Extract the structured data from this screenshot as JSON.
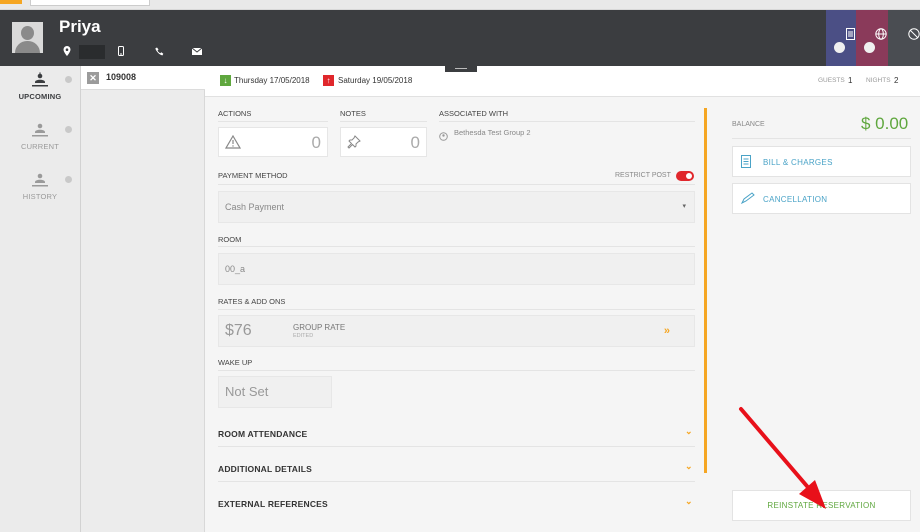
{
  "guest": {
    "name": "Priya"
  },
  "sidebar": {
    "items": [
      {
        "label": "UPCOMING",
        "icon": "upcoming-icon",
        "active": true
      },
      {
        "label": "CURRENT",
        "icon": "current-icon",
        "active": false
      },
      {
        "label": "HISTORY",
        "icon": "history-icon",
        "active": false
      }
    ]
  },
  "reservations": [
    {
      "number": "109008"
    }
  ],
  "stay": {
    "arrival": "Thursday 17/05/2018",
    "departure": "Saturday 19/05/2018",
    "guests_label": "GUESTS",
    "guests": "1",
    "nights_label": "NIGHTS",
    "nights": "2"
  },
  "actions": {
    "label": "ACTIONS",
    "count": "0"
  },
  "notes": {
    "label": "NOTES",
    "count": "0"
  },
  "associated": {
    "label": "ASSOCIATED WITH",
    "value": "Bethesda Test Group 2"
  },
  "payment": {
    "label": "PAYMENT METHOD",
    "restrict_label": "RESTRICT POST",
    "value": "Cash Payment"
  },
  "room": {
    "label": "ROOM",
    "value": "00_a"
  },
  "rates": {
    "label": "RATES & ADD ONS",
    "amount": "$76",
    "rate_name": "GROUP RATE",
    "rate_status": "EDITED"
  },
  "wakeup": {
    "label": "WAKE UP",
    "value": "Not Set"
  },
  "sections": [
    {
      "label": "ROOM ATTENDANCE"
    },
    {
      "label": "ADDITIONAL DETAILS"
    },
    {
      "label": "EXTERNAL REFERENCES"
    }
  ],
  "balance": {
    "label": "BALANCE",
    "value": "$ 0.00"
  },
  "buttons": {
    "bill_charges": "BILL & CHARGES",
    "cancellation": "CANCELLATION",
    "reinstate": "REINSTATE RESERVATION"
  },
  "colors": {
    "accent": "#f5a623",
    "success": "#5fa73e",
    "danger": "#e0272c",
    "link": "#4aa3c7"
  }
}
